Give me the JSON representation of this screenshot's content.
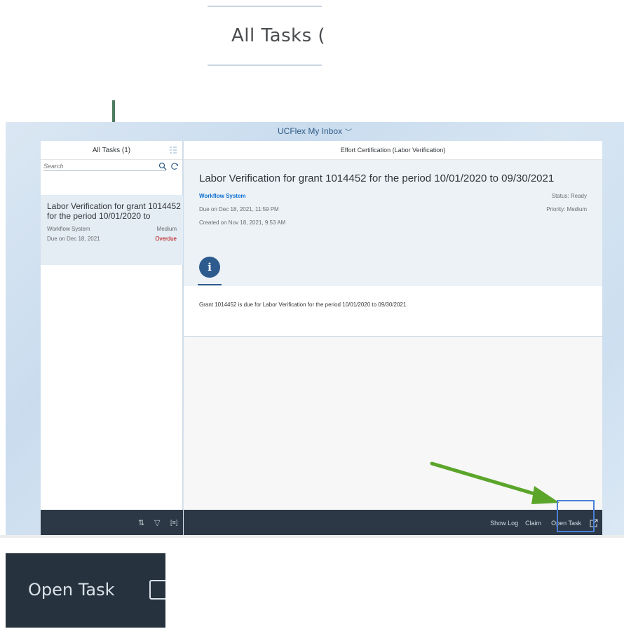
{
  "zoom_top": {
    "text": "All Tasks ("
  },
  "shell": {
    "title": "UCFlex My Inbox",
    "chevron": "﹀"
  },
  "master": {
    "header": "All Tasks (1)",
    "search_placeholder": "Search",
    "items": [
      {
        "title": "Labor Verification for grant 1014452 for the period 10/01/2020 to",
        "source": "Workflow System",
        "priority": "Medium",
        "due": "Due on Dec 18, 2021",
        "status": "Overdue"
      }
    ],
    "footer_icons": [
      "sort-icon",
      "filter-icon",
      "group-icon"
    ]
  },
  "detail": {
    "header": "Effort Certification (Labor Verification)",
    "title": "Labor Verification for grant 1014452 for the period 10/01/2020 to 09/30/2021",
    "created_by": "Workflow System",
    "status": "Status: Ready",
    "due": "Due on Dec 18, 2021, 11:59 PM",
    "priority": "Priority: Medium",
    "created": "Created on Nov 18, 2021, 9:53 AM",
    "info_tab_glyph": "i",
    "description": "Grant 1014452 is due for Labor Verification for the period 10/01/2020 to 09/30/2021."
  },
  "footer": {
    "show_log": "Show Log",
    "claim": "Claim",
    "open_task": "Open Task"
  },
  "zoom_bottom": {
    "text": "Open Task"
  },
  "colors": {
    "shell_text": "#2f5a86",
    "footer_bg": "#2c3845",
    "link": "#0a6ed1",
    "overdue": "#bb0000",
    "annotation_green": "#5aa52a",
    "annotation_arrow": "#4d7a60",
    "highlight": "#4a7fd6"
  }
}
